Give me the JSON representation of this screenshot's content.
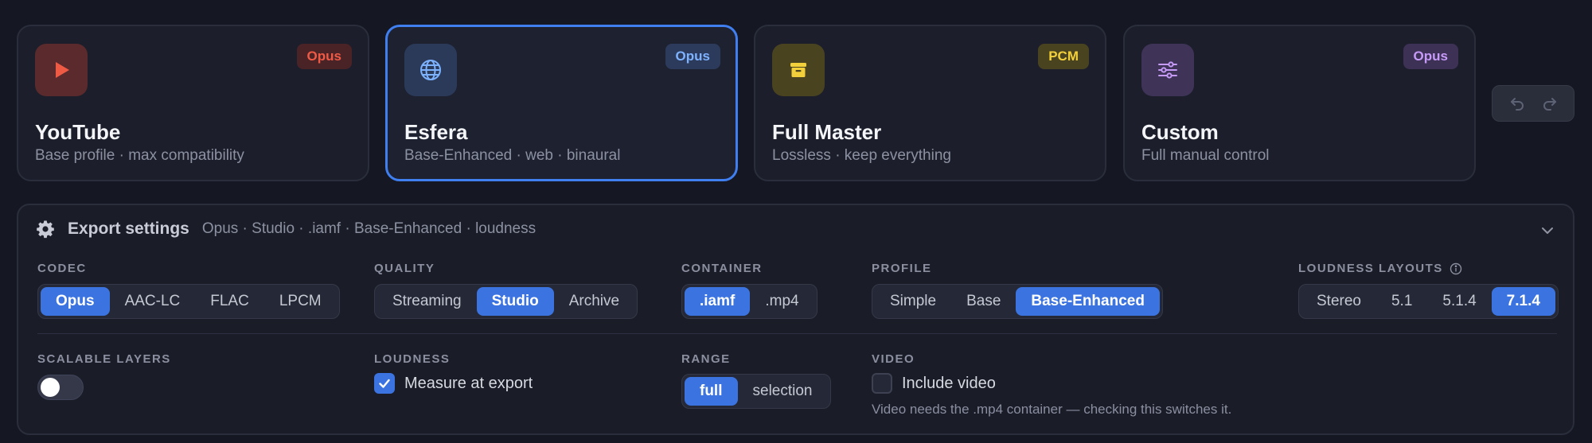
{
  "presets": [
    {
      "title": "YouTube",
      "subtitle": "Base profile · max compatibility",
      "badge": "Opus",
      "icon": "play-icon"
    },
    {
      "title": "Esfera",
      "subtitle": "Base-Enhanced · web · binaural",
      "badge": "Opus",
      "icon": "globe-icon",
      "selected": true
    },
    {
      "title": "Full Master",
      "subtitle": "Lossless · keep everything",
      "badge": "PCM",
      "icon": "archive-box-icon"
    },
    {
      "title": "Custom",
      "subtitle": "Full manual control",
      "badge": "Opus",
      "icon": "sliders-icon"
    }
  ],
  "colors": {
    "accent": "#3f7ff0",
    "youtube_badge": "#ef5a45",
    "esfera_badge": "#7db2ff",
    "pcm_badge": "#f2d03b",
    "custom_badge": "#c69af7"
  },
  "settings": {
    "title": "Export settings",
    "summary": "Opus · Studio · .iamf · Base-Enhanced · loudness",
    "codec": {
      "label": "CODEC",
      "options": [
        "Opus",
        "AAC-LC",
        "FLAC",
        "LPCM"
      ],
      "selected": "Opus"
    },
    "quality": {
      "label": "QUALITY",
      "options": [
        "Streaming",
        "Studio",
        "Archive"
      ],
      "selected": "Studio"
    },
    "container": {
      "label": "CONTAINER",
      "options": [
        ".iamf",
        ".mp4"
      ],
      "selected": ".iamf"
    },
    "profile": {
      "label": "PROFILE",
      "options": [
        "Simple",
        "Base",
        "Base-Enhanced"
      ],
      "selected": "Base-Enhanced"
    },
    "loudness_layouts": {
      "label": "LOUDNESS LAYOUTS",
      "options": [
        "Stereo",
        "5.1",
        "5.1.4",
        "7.1.4"
      ],
      "selected": "7.1.4"
    },
    "scalable_layers": {
      "label": "SCALABLE LAYERS",
      "enabled": false
    },
    "loudness": {
      "label": "LOUDNESS",
      "checkbox_label": "Measure at export",
      "checked": true
    },
    "range": {
      "label": "RANGE",
      "options": [
        "full",
        "selection"
      ],
      "selected": "full"
    },
    "video": {
      "label": "VIDEO",
      "checkbox_label": "Include video",
      "checked": false,
      "note": "Video needs the .mp4 container — checking this switches it."
    }
  }
}
